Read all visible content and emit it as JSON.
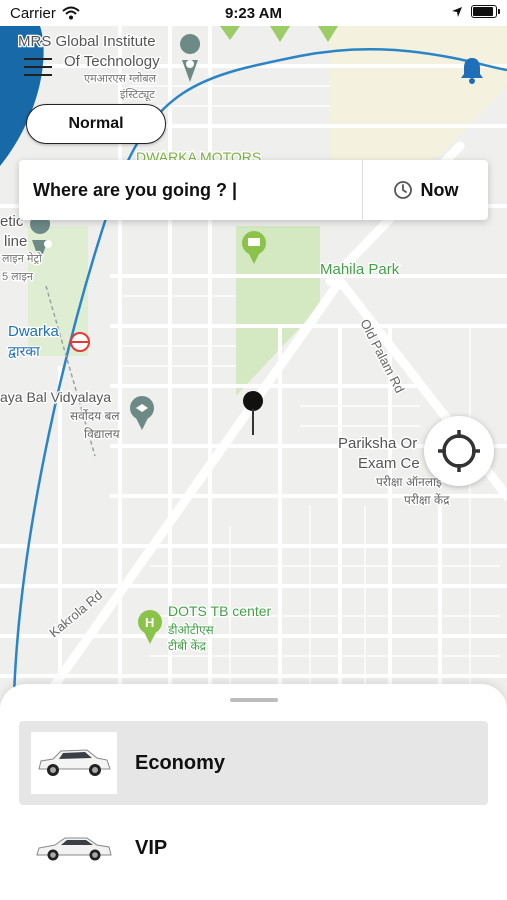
{
  "status_bar": {
    "carrier": "Carrier",
    "time": "9:23 AM"
  },
  "header": {
    "mode": "Normal"
  },
  "search": {
    "destination": "Where are you going ? |",
    "when": "Now"
  },
  "map": {
    "labels": [
      {
        "text": "MRS Global Institute",
        "color": "#555"
      },
      {
        "text": "Of Technology",
        "color": "#555"
      },
      {
        "text": "एमआरएस ग्लोबल",
        "color": "#777"
      },
      {
        "text": "इंस्टिट्यूट",
        "color": "#777"
      },
      {
        "text": "DWARKA MOTORS",
        "color": "#7cb342"
      },
      {
        "text": "etic",
        "color": "#555"
      },
      {
        "text": "line",
        "color": "#555"
      },
      {
        "text": "लाइन मेट्रो",
        "color": "#777"
      },
      {
        "text": "5 लाइन",
        "color": "#777"
      },
      {
        "text": "Mahila Park",
        "color": "#43a047"
      },
      {
        "text": "Dwarka",
        "color": "#1e6fb8"
      },
      {
        "text": "द्वारका",
        "color": "#1e6fb8"
      },
      {
        "text": "Old Palam Rd",
        "color": "#666"
      },
      {
        "text": "aya Bal Vidyalaya",
        "color": "#555"
      },
      {
        "text": "सर्वोदय बल",
        "color": "#666"
      },
      {
        "text": "विद्यालय",
        "color": "#666"
      },
      {
        "text": "Pariksha Or",
        "color": "#555"
      },
      {
        "text": "Exam Ce",
        "color": "#555"
      },
      {
        "text": "परीक्षा ऑनलाइ",
        "color": "#666"
      },
      {
        "text": "परीक्षा केंद्र",
        "color": "#666"
      },
      {
        "text": "Kakrola Rd",
        "color": "#666"
      },
      {
        "text": "DOTS TB center",
        "color": "#43a047"
      },
      {
        "text": "डीओटीएस",
        "color": "#43a047"
      },
      {
        "text": "टीबी केंद्र",
        "color": "#43a047"
      }
    ]
  },
  "rides": [
    {
      "label": "Economy",
      "selected": true
    },
    {
      "label": "VIP",
      "selected": false
    }
  ],
  "colors": {
    "accent": "#1e6fb8",
    "park": "#cfe8b8",
    "road": "#ffffff",
    "map_bg": "#eeeeec"
  }
}
